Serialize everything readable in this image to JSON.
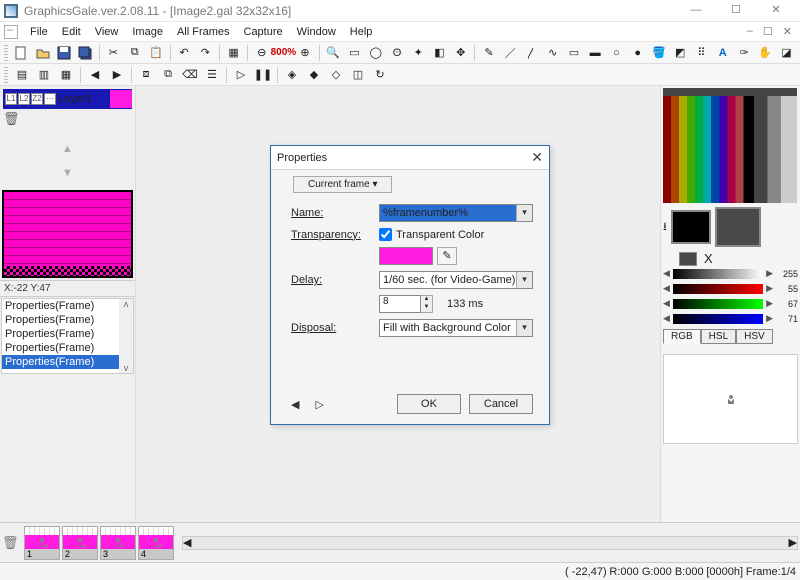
{
  "title": "GraphicsGale.ver.2.08.11 - [Image2.gal 32x32x16]",
  "win": {
    "min": "—",
    "max": "☐",
    "close": "✕"
  },
  "menu": [
    "File",
    "Edit",
    "View",
    "Image",
    "All Frames",
    "Capture",
    "Window",
    "Help"
  ],
  "menu_right": [
    "–",
    "☐",
    "✕"
  ],
  "zoom": "800%",
  "layer": {
    "label": "Layer1",
    "icons": [
      "L1",
      "L2",
      "Z2",
      "⋯"
    ]
  },
  "coord": "X:-22 Y:47",
  "proplist": [
    "Properties(Frame)",
    "Properties(Frame)",
    "Properties(Frame)",
    "Properties(Frame)",
    "Properties(Frame)"
  ],
  "sliders": {
    "gray": "255",
    "r": "55",
    "g": "67",
    "b": "71"
  },
  "colortabs": [
    "RGB",
    "HSL",
    "HSV"
  ],
  "frames": [
    "1",
    "2",
    "3",
    "4"
  ],
  "status": {
    "coords": "( -22,47)",
    "rgb": "R:000 G:000 B:000",
    "hex": "[0000h]",
    "frame": "Frame:1/4"
  },
  "dialog": {
    "title": "Properties",
    "tab": "Current frame ▾",
    "name_lbl": "Name:",
    "name_val": "%framenumber%",
    "trans_lbl": "Transparency:",
    "trans_chk": "Transparent Color",
    "delay_lbl": "Delay:",
    "delay_combo": "1/60 sec. (for Video-Game)",
    "delay_spin": "8",
    "delay_ms": "133 ms",
    "disp_lbl": "Disposal:",
    "disp_combo": "Fill with Background Color",
    "ok": "OK",
    "cancel": "Cancel"
  }
}
